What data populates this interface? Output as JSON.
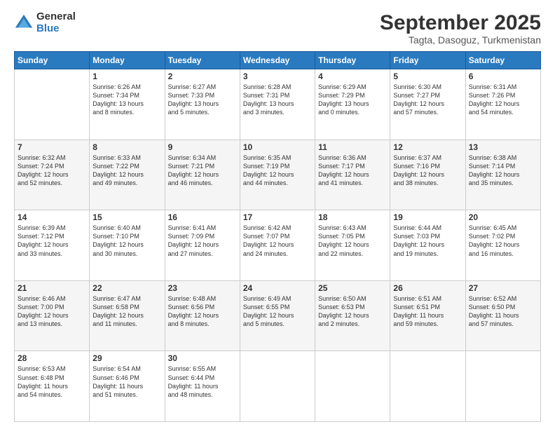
{
  "logo": {
    "general": "General",
    "blue": "Blue"
  },
  "title": "September 2025",
  "subtitle": "Tagta, Dasoguz, Turkmenistan",
  "headers": [
    "Sunday",
    "Monday",
    "Tuesday",
    "Wednesday",
    "Thursday",
    "Friday",
    "Saturday"
  ],
  "weeks": [
    [
      {
        "num": "",
        "info": ""
      },
      {
        "num": "1",
        "info": "Sunrise: 6:26 AM\nSunset: 7:34 PM\nDaylight: 13 hours\nand 8 minutes."
      },
      {
        "num": "2",
        "info": "Sunrise: 6:27 AM\nSunset: 7:33 PM\nDaylight: 13 hours\nand 5 minutes."
      },
      {
        "num": "3",
        "info": "Sunrise: 6:28 AM\nSunset: 7:31 PM\nDaylight: 13 hours\nand 3 minutes."
      },
      {
        "num": "4",
        "info": "Sunrise: 6:29 AM\nSunset: 7:29 PM\nDaylight: 13 hours\nand 0 minutes."
      },
      {
        "num": "5",
        "info": "Sunrise: 6:30 AM\nSunset: 7:27 PM\nDaylight: 12 hours\nand 57 minutes."
      },
      {
        "num": "6",
        "info": "Sunrise: 6:31 AM\nSunset: 7:26 PM\nDaylight: 12 hours\nand 54 minutes."
      }
    ],
    [
      {
        "num": "7",
        "info": "Sunrise: 6:32 AM\nSunset: 7:24 PM\nDaylight: 12 hours\nand 52 minutes."
      },
      {
        "num": "8",
        "info": "Sunrise: 6:33 AM\nSunset: 7:22 PM\nDaylight: 12 hours\nand 49 minutes."
      },
      {
        "num": "9",
        "info": "Sunrise: 6:34 AM\nSunset: 7:21 PM\nDaylight: 12 hours\nand 46 minutes."
      },
      {
        "num": "10",
        "info": "Sunrise: 6:35 AM\nSunset: 7:19 PM\nDaylight: 12 hours\nand 44 minutes."
      },
      {
        "num": "11",
        "info": "Sunrise: 6:36 AM\nSunset: 7:17 PM\nDaylight: 12 hours\nand 41 minutes."
      },
      {
        "num": "12",
        "info": "Sunrise: 6:37 AM\nSunset: 7:16 PM\nDaylight: 12 hours\nand 38 minutes."
      },
      {
        "num": "13",
        "info": "Sunrise: 6:38 AM\nSunset: 7:14 PM\nDaylight: 12 hours\nand 35 minutes."
      }
    ],
    [
      {
        "num": "14",
        "info": "Sunrise: 6:39 AM\nSunset: 7:12 PM\nDaylight: 12 hours\nand 33 minutes."
      },
      {
        "num": "15",
        "info": "Sunrise: 6:40 AM\nSunset: 7:10 PM\nDaylight: 12 hours\nand 30 minutes."
      },
      {
        "num": "16",
        "info": "Sunrise: 6:41 AM\nSunset: 7:09 PM\nDaylight: 12 hours\nand 27 minutes."
      },
      {
        "num": "17",
        "info": "Sunrise: 6:42 AM\nSunset: 7:07 PM\nDaylight: 12 hours\nand 24 minutes."
      },
      {
        "num": "18",
        "info": "Sunrise: 6:43 AM\nSunset: 7:05 PM\nDaylight: 12 hours\nand 22 minutes."
      },
      {
        "num": "19",
        "info": "Sunrise: 6:44 AM\nSunset: 7:03 PM\nDaylight: 12 hours\nand 19 minutes."
      },
      {
        "num": "20",
        "info": "Sunrise: 6:45 AM\nSunset: 7:02 PM\nDaylight: 12 hours\nand 16 minutes."
      }
    ],
    [
      {
        "num": "21",
        "info": "Sunrise: 6:46 AM\nSunset: 7:00 PM\nDaylight: 12 hours\nand 13 minutes."
      },
      {
        "num": "22",
        "info": "Sunrise: 6:47 AM\nSunset: 6:58 PM\nDaylight: 12 hours\nand 11 minutes."
      },
      {
        "num": "23",
        "info": "Sunrise: 6:48 AM\nSunset: 6:56 PM\nDaylight: 12 hours\nand 8 minutes."
      },
      {
        "num": "24",
        "info": "Sunrise: 6:49 AM\nSunset: 6:55 PM\nDaylight: 12 hours\nand 5 minutes."
      },
      {
        "num": "25",
        "info": "Sunrise: 6:50 AM\nSunset: 6:53 PM\nDaylight: 12 hours\nand 2 minutes."
      },
      {
        "num": "26",
        "info": "Sunrise: 6:51 AM\nSunset: 6:51 PM\nDaylight: 11 hours\nand 59 minutes."
      },
      {
        "num": "27",
        "info": "Sunrise: 6:52 AM\nSunset: 6:50 PM\nDaylight: 11 hours\nand 57 minutes."
      }
    ],
    [
      {
        "num": "28",
        "info": "Sunrise: 6:53 AM\nSunset: 6:48 PM\nDaylight: 11 hours\nand 54 minutes."
      },
      {
        "num": "29",
        "info": "Sunrise: 6:54 AM\nSunset: 6:46 PM\nDaylight: 11 hours\nand 51 minutes."
      },
      {
        "num": "30",
        "info": "Sunrise: 6:55 AM\nSunset: 6:44 PM\nDaylight: 11 hours\nand 48 minutes."
      },
      {
        "num": "",
        "info": ""
      },
      {
        "num": "",
        "info": ""
      },
      {
        "num": "",
        "info": ""
      },
      {
        "num": "",
        "info": ""
      }
    ]
  ]
}
